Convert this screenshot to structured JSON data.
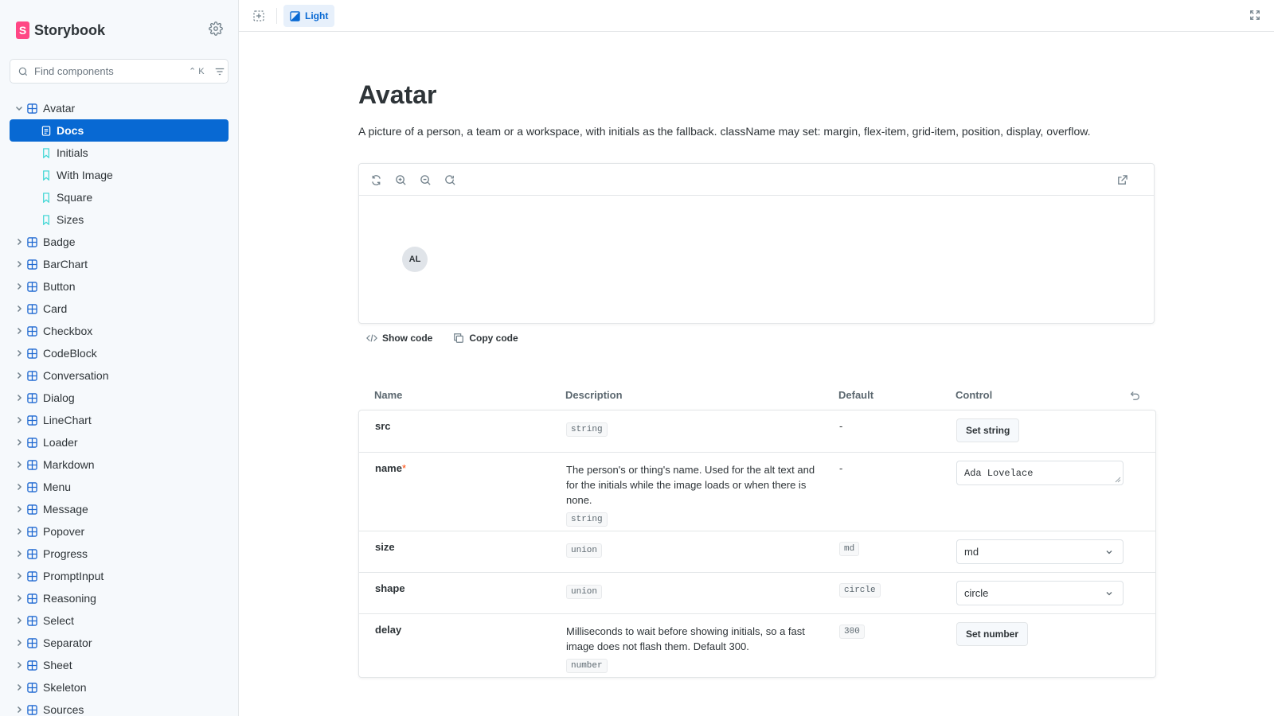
{
  "brand": {
    "name": "Storybook",
    "mark": "S"
  },
  "search": {
    "placeholder": "Find components",
    "shortcut": "⌃ K"
  },
  "sidebar": {
    "expanded": {
      "label": "Avatar",
      "children": [
        {
          "label": "Docs",
          "type": "docs",
          "active": true
        },
        {
          "label": "Initials",
          "type": "story"
        },
        {
          "label": "With Image",
          "type": "story"
        },
        {
          "label": "Square",
          "type": "story"
        },
        {
          "label": "Sizes",
          "type": "story"
        }
      ]
    },
    "components": [
      "Badge",
      "BarChart",
      "Button",
      "Card",
      "Checkbox",
      "CodeBlock",
      "Conversation",
      "Dialog",
      "LineChart",
      "Loader",
      "Markdown",
      "Menu",
      "Message",
      "Popover",
      "Progress",
      "PromptInput",
      "Reasoning",
      "Select",
      "Separator",
      "Sheet",
      "Skeleton",
      "Sources"
    ]
  },
  "toolbar": {
    "theme_label": "Light"
  },
  "doc": {
    "title": "Avatar",
    "description": "A picture of a person, a team or a workspace, with initials as the fallback. className may set: margin, flex-item, grid-item, position, display, overflow.",
    "preview_avatar": "AL",
    "show_code": "Show code",
    "copy_code": "Copy code"
  },
  "args_table": {
    "headers": {
      "name": "Name",
      "description": "Description",
      "default": "Default",
      "control": "Control"
    },
    "rows": [
      {
        "name": "src",
        "required": false,
        "description": "",
        "type": "string",
        "default": "-",
        "default_is_code": false,
        "control": {
          "kind": "button",
          "label": "Set string"
        }
      },
      {
        "name": "name",
        "required": true,
        "description": "The person's or thing's name. Used for the alt text and for the initials while the image loads or when there is none.",
        "type": "string",
        "default": "-",
        "default_is_code": false,
        "control": {
          "kind": "text",
          "value": "Ada Lovelace"
        }
      },
      {
        "name": "size",
        "required": false,
        "description": "",
        "type": "union",
        "default": "md",
        "default_is_code": true,
        "control": {
          "kind": "select",
          "value": "md"
        }
      },
      {
        "name": "shape",
        "required": false,
        "description": "",
        "type": "union",
        "default": "circle",
        "default_is_code": true,
        "control": {
          "kind": "select",
          "value": "circle"
        }
      },
      {
        "name": "delay",
        "required": false,
        "description": "Milliseconds to wait before showing initials, so a fast image does not flash them. Default 300.",
        "type": "number",
        "default": "300",
        "default_is_code": true,
        "control": {
          "kind": "button",
          "label": "Set number"
        }
      }
    ]
  },
  "colors": {
    "accent": "#0869d3",
    "brand": "#ff4785",
    "story_icon": "#37d5d3",
    "component_icon": "#1e68d1"
  },
  "icons": [
    "settings-icon",
    "search-icon",
    "filter-icon",
    "chevron-down-icon",
    "chevron-right-icon",
    "component-icon",
    "docs-icon",
    "bookmark-icon",
    "outline-icon",
    "theme-icon",
    "fullscreen-icon",
    "remount-icon",
    "zoom-in-icon",
    "zoom-out-icon",
    "zoom-reset-icon",
    "open-new-icon",
    "code-icon",
    "copy-icon",
    "reset-icon"
  ]
}
